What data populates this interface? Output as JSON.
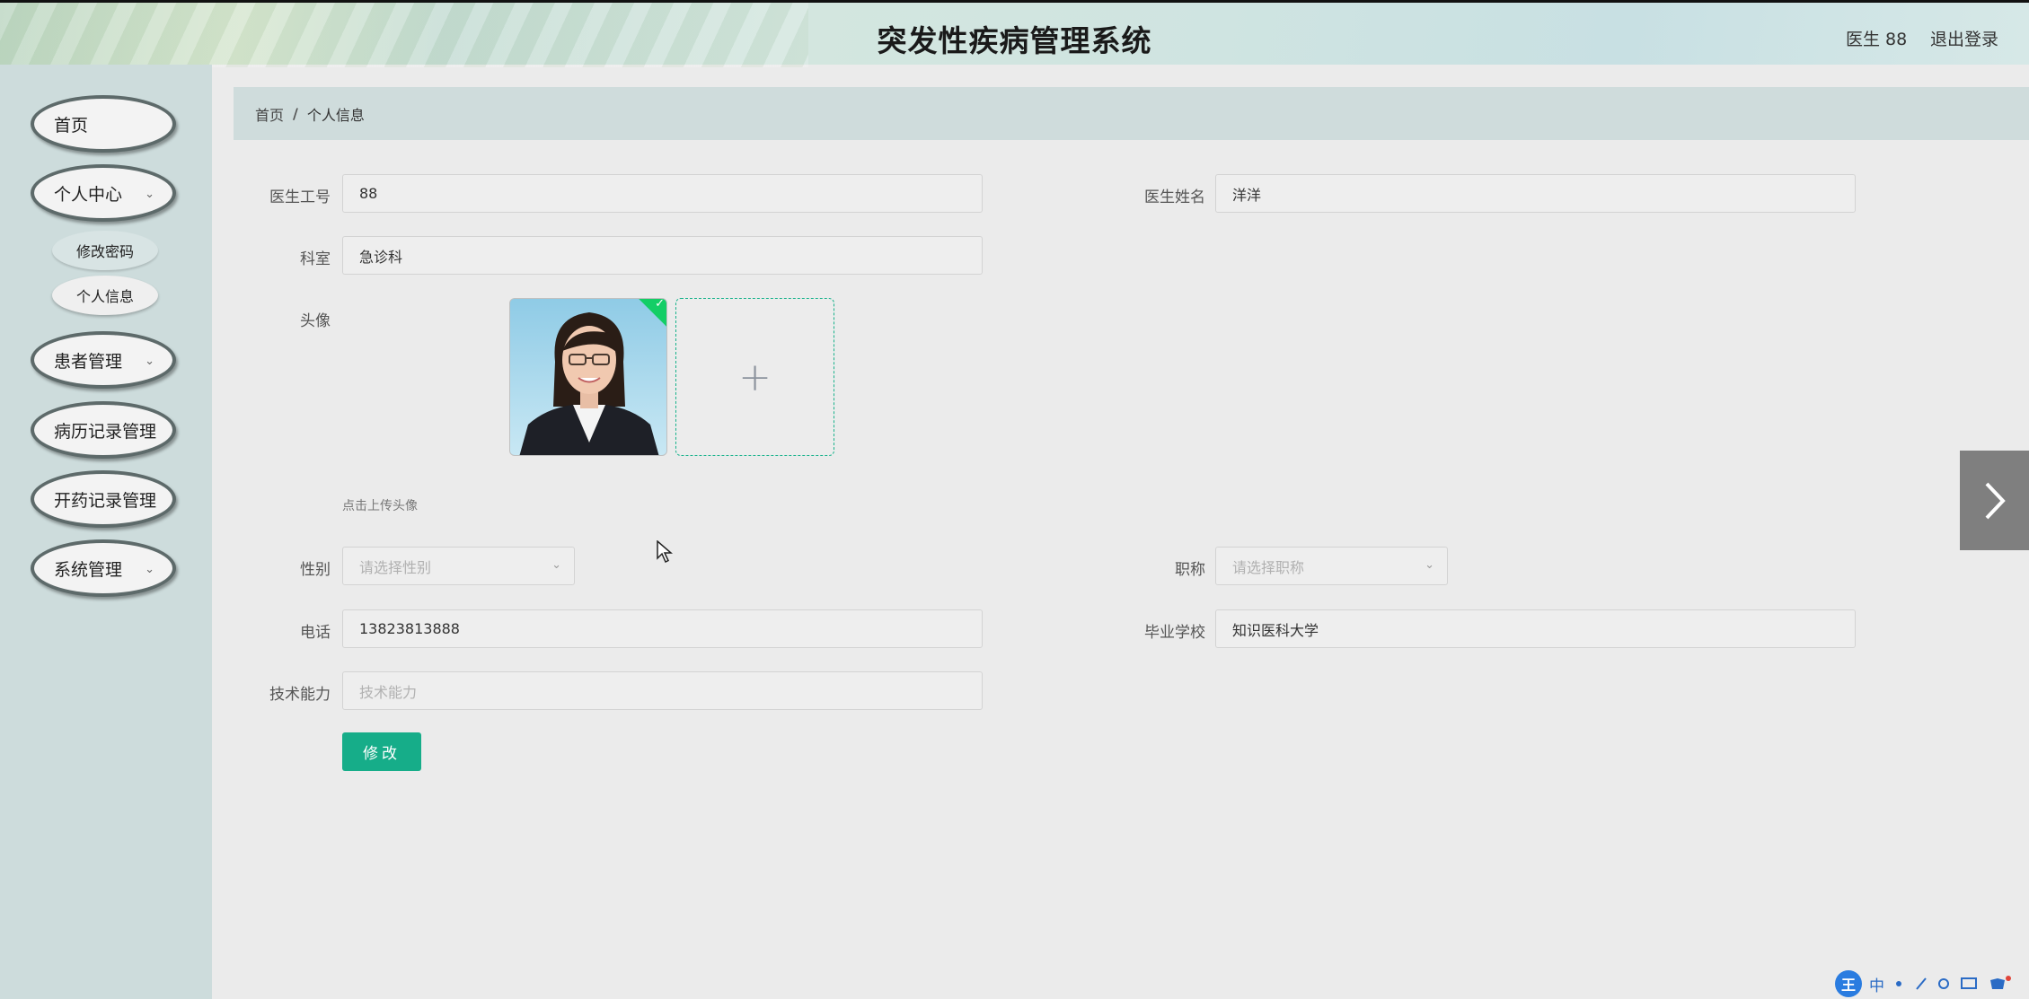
{
  "header": {
    "title": "突发性疾病管理系统",
    "user": "医生 88",
    "logout": "退出登录"
  },
  "sidebar": {
    "items": [
      {
        "label": "首页"
      },
      {
        "label": "个人中心"
      },
      {
        "label": "修改密码"
      },
      {
        "label": "个人信息"
      },
      {
        "label": "患者管理"
      },
      {
        "label": "病历记录管理"
      },
      {
        "label": "开药记录管理"
      },
      {
        "label": "系统管理"
      }
    ]
  },
  "breadcrumb": {
    "home": "首页",
    "separator": "/",
    "current": "个人信息"
  },
  "form": {
    "doctor_id_label": "医生工号",
    "doctor_id_value": "88",
    "doctor_name_label": "医生姓名",
    "doctor_name_value": "洋洋",
    "department_label": "科室",
    "department_value": "急诊科",
    "avatar_label": "头像",
    "upload_plus": "+",
    "upload_hint": "点击上传头像",
    "gender_label": "性别",
    "gender_placeholder": "请选择性别",
    "title_label": "职称",
    "title_placeholder": "请选择职称",
    "phone_label": "电话",
    "phone_value": "13823813888",
    "school_label": "毕业学校",
    "school_value": "知识医科大学",
    "skill_label": "技术能力",
    "skill_placeholder": "技术能力",
    "submit_label": "修改",
    "upload_success_mark": "✓"
  },
  "ime": {
    "logo": "王",
    "mode": "中"
  },
  "colors": {
    "primary": "#16ad89",
    "success": "#13ce66",
    "sidebar_bg": "#cddcdc",
    "breadcrumb_bg": "#cfdcdc",
    "page_bg": "#ebebeb"
  }
}
